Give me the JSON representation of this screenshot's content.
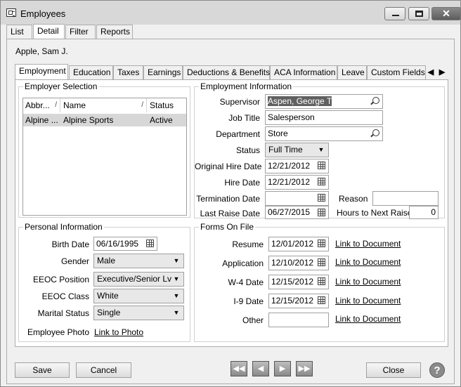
{
  "window": {
    "title": "Employees"
  },
  "main_tabs": [
    "List",
    "Detail",
    "Filter",
    "Reports"
  ],
  "employee_name": "Apple, Sam J.",
  "sub_tabs": [
    "Employment",
    "Education",
    "Taxes",
    "Earnings",
    "Deductions & Benefits",
    "ACA Information",
    "Leave",
    "Custom Fields"
  ],
  "employer_selection": {
    "label": "Employer Selection",
    "columns": [
      "Abbr...",
      "Name",
      "Status"
    ],
    "rows": [
      {
        "abbr": "Alpine ...",
        "name": "Alpine Sports",
        "status": "Active"
      }
    ]
  },
  "employment_info": {
    "label": "Employment Information",
    "supervisor_label": "Supervisor",
    "supervisor": "Aspen, George T",
    "job_title_label": "Job Title",
    "job_title": "Salesperson",
    "department_label": "Department",
    "department": "Store",
    "status_label": "Status",
    "status": "Full Time",
    "orig_hire_label": "Original Hire Date",
    "orig_hire": "12/21/2012",
    "hire_label": "Hire Date",
    "hire": "12/21/2012",
    "term_label": "Termination Date",
    "term": "",
    "reason_label": "Reason",
    "reason": "",
    "last_raise_label": "Last Raise Date",
    "last_raise": "06/27/2015",
    "hours_label": "Hours to Next Raise",
    "hours": "0"
  },
  "personal_info": {
    "label": "Personal Information",
    "birth_label": "Birth Date",
    "birth": "06/16/1995",
    "gender_label": "Gender",
    "gender": "Male",
    "eeoc_pos_label": "EEOC Position",
    "eeoc_pos": "Executive/Senior Lvl C",
    "eeoc_class_label": "EEOC Class",
    "eeoc_class": "White",
    "marital_label": "Marital Status",
    "marital": "Single",
    "photo_label": "Employee Photo",
    "photo_link": "Link to Photo"
  },
  "forms": {
    "label": "Forms On File",
    "items": [
      {
        "label": "Resume",
        "date": "12/01/2012",
        "link": "Link to Document"
      },
      {
        "label": "Application",
        "date": "12/10/2012",
        "link": "Link to Document"
      },
      {
        "label": "W-4 Date",
        "date": "12/15/2012",
        "link": "Link to Document"
      },
      {
        "label": "I-9 Date",
        "date": "12/15/2012",
        "link": "Link to Document"
      },
      {
        "label": "Other",
        "date": "",
        "link": "Link to Document"
      }
    ]
  },
  "buttons": {
    "save": "Save",
    "cancel": "Cancel",
    "close": "Close"
  },
  "icons": {
    "nav_first": "first-record-icon",
    "nav_prev": "prev-record-icon",
    "nav_next": "next-record-icon",
    "nav_last": "last-record-icon",
    "help": "help-icon"
  }
}
